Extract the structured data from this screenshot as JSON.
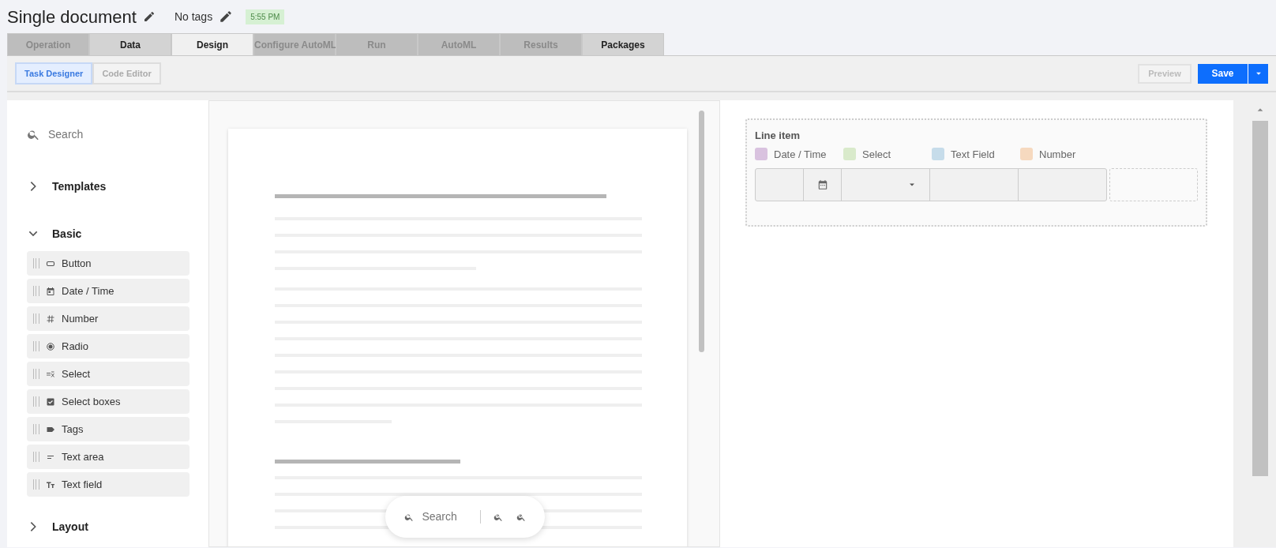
{
  "header": {
    "title": "Single document",
    "tags": "No tags",
    "time": "5:55 PM"
  },
  "tabs": [
    {
      "label": "Operation",
      "selected": false,
      "disabled": true
    },
    {
      "label": "Data",
      "selected": false,
      "disabled": false
    },
    {
      "label": "Design",
      "selected": true,
      "disabled": false
    },
    {
      "label": "Configure AutoML",
      "selected": false,
      "disabled": true
    },
    {
      "label": "Run",
      "selected": false,
      "disabled": true
    },
    {
      "label": "AutoML",
      "selected": false,
      "disabled": true
    },
    {
      "label": "Results",
      "selected": false,
      "disabled": true
    },
    {
      "label": "Packages",
      "selected": false,
      "disabled": false
    }
  ],
  "mode_buttons": [
    {
      "label": "Task Designer",
      "selected": true
    },
    {
      "label": "Code Editor",
      "selected": false
    }
  ],
  "actions": {
    "preview": {
      "label": "Preview",
      "disabled": true
    },
    "save": {
      "label": "Save"
    }
  },
  "sidebar": {
    "search": {
      "placeholder": "Search"
    },
    "sections": [
      {
        "label": "Templates",
        "expanded": false
      },
      {
        "label": "Basic",
        "expanded": true,
        "items": [
          {
            "label": "Button",
            "kind": "button"
          },
          {
            "label": "Date / Time",
            "kind": "datetime"
          },
          {
            "label": "Number",
            "kind": "number"
          },
          {
            "label": "Radio",
            "kind": "radio"
          },
          {
            "label": "Select",
            "kind": "select"
          },
          {
            "label": "Select boxes",
            "kind": "selectboxes"
          },
          {
            "label": "Tags",
            "kind": "tags"
          },
          {
            "label": "Text area",
            "kind": "textarea"
          },
          {
            "label": "Text field",
            "kind": "textfield"
          }
        ]
      },
      {
        "label": "Layout",
        "expanded": false
      }
    ]
  },
  "document_toolbar": {
    "search": {
      "placeholder": "Search"
    }
  },
  "line_item": {
    "title": "Line item",
    "legend": [
      {
        "label": "Date / Time",
        "color": "#d9c2df"
      },
      {
        "label": "Select",
        "color": "#d9eacb"
      },
      {
        "label": "Text Field",
        "color": "#c6dcea"
      },
      {
        "label": "Number",
        "color": "#f6d9bf"
      }
    ],
    "fields": [
      {
        "kind": "date"
      },
      {
        "kind": "select"
      },
      {
        "kind": "text"
      },
      {
        "kind": "number"
      }
    ]
  }
}
